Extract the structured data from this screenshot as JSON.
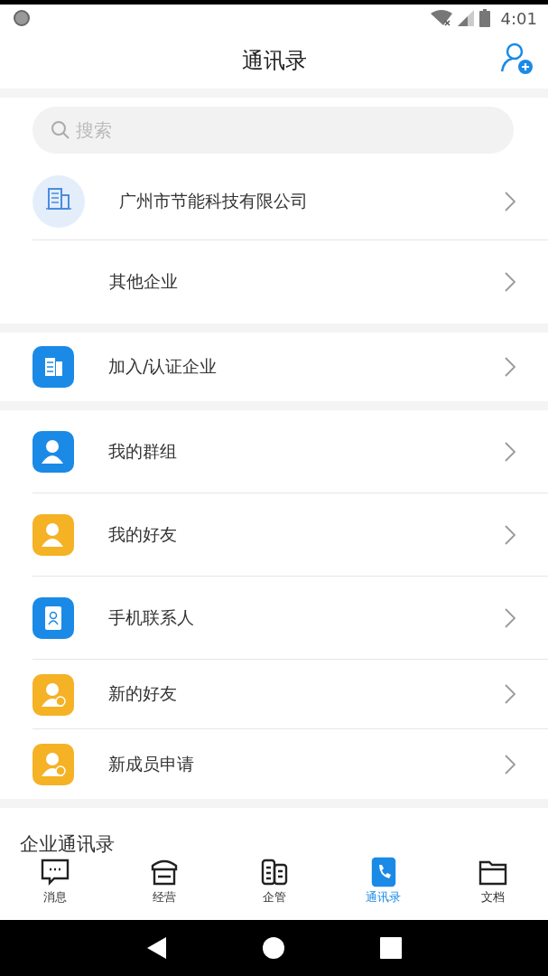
{
  "status_bar": {
    "time": "4:01"
  },
  "header": {
    "title": "通讯录"
  },
  "search": {
    "placeholder": "搜索"
  },
  "companies": [
    {
      "label": "广州市节能科技有限公司",
      "kind": "company"
    },
    {
      "label": "其他企业",
      "kind": "plain"
    }
  ],
  "join": {
    "label": "加入/认证企业",
    "color": "#1a8ae6"
  },
  "contacts": [
    {
      "label": "我的群组",
      "color": "#1a8ae6"
    },
    {
      "label": "我的好友",
      "color": "#f5b225"
    },
    {
      "label": "手机联系人",
      "color": "#1a8ae6"
    },
    {
      "label": "新的好友",
      "color": "#f5b225"
    },
    {
      "label": "新成员申请",
      "color": "#f5b225"
    }
  ],
  "section_title": "企业通讯录",
  "tabs": [
    {
      "label": "消息",
      "selected": false
    },
    {
      "label": "经营",
      "selected": false
    },
    {
      "label": "企管",
      "selected": false
    },
    {
      "label": "通讯录",
      "selected": true
    },
    {
      "label": "文档",
      "selected": false
    }
  ]
}
